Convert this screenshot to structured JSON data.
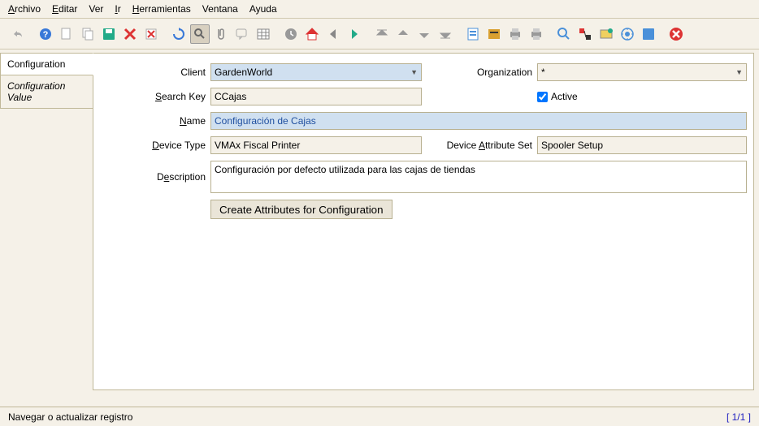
{
  "menu": {
    "archivo": "Archivo",
    "editar": "Editar",
    "ver": "Ver",
    "ir": "Ir",
    "herramientas": "Herramientas",
    "ventana": "Ventana",
    "ayuda": "Ayuda"
  },
  "tabs": {
    "configuration": "Configuration",
    "configuration_value": "Configuration Value"
  },
  "labels": {
    "client": "Client",
    "organization": "Organization",
    "search_key": "Search Key",
    "active": "Active",
    "name": "Name",
    "device_type": "Device Type",
    "device_attribute_set": "Device Attribute Set",
    "description": "Description"
  },
  "values": {
    "client": "GardenWorld",
    "organization": "*",
    "search_key": "CCajas",
    "name": "Configuración de Cajas",
    "device_type": "VMAx Fiscal Printer",
    "device_attribute_set": "Spooler Setup",
    "description": "Configuración por defecto utilizada para las cajas de tiendas"
  },
  "buttons": {
    "create_attributes": "Create Attributes for Configuration"
  },
  "footer": {
    "status": "Navegar o actualizar registro",
    "pager": "[  1/1  ]"
  }
}
